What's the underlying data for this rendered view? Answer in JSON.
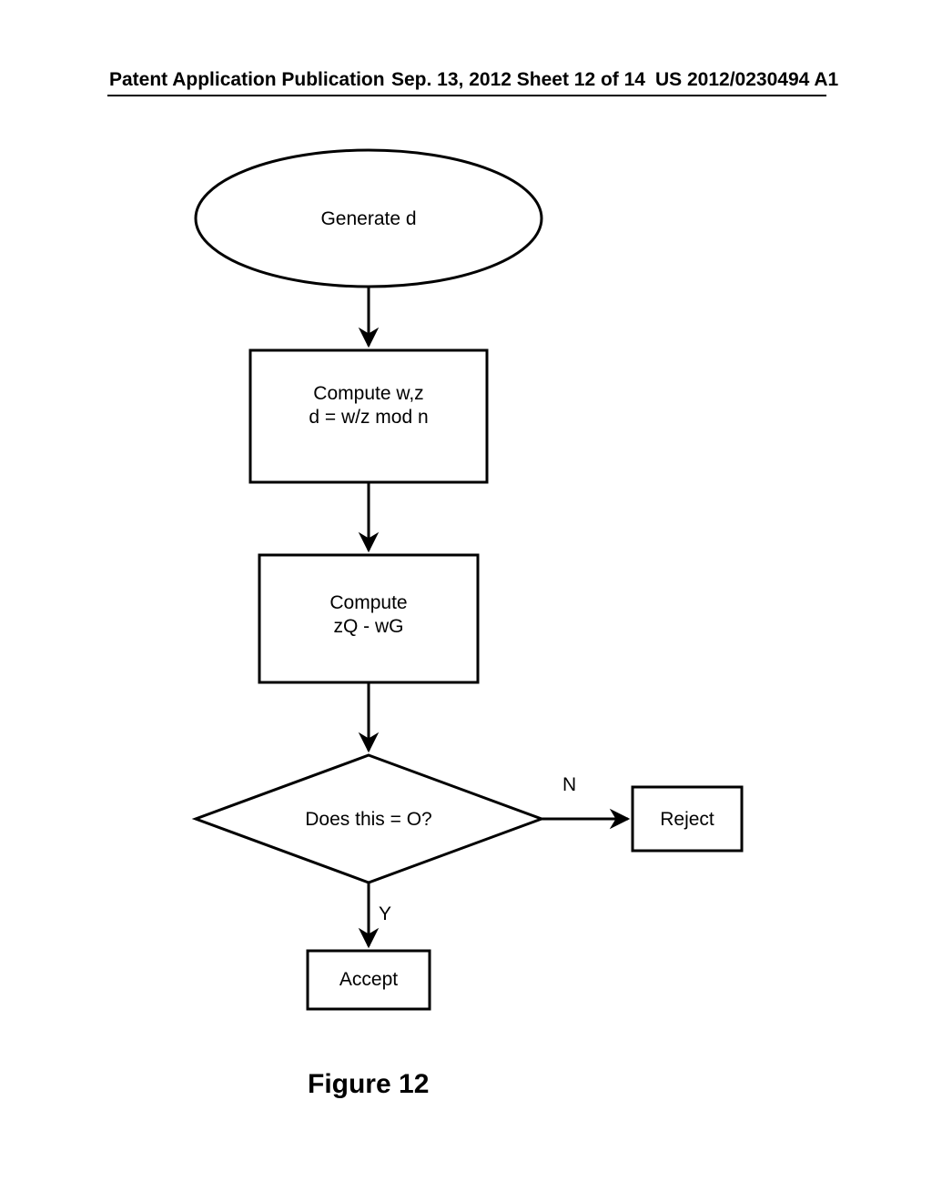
{
  "header": {
    "left": "Patent Application Publication",
    "center": "Sep. 13, 2012  Sheet 12 of 14",
    "right": "US 2012/0230494 A1"
  },
  "flow": {
    "start": "Generate d",
    "step1_line1": "Compute w,z",
    "step1_line2": "d = w/z mod n",
    "step2_line1": "Compute",
    "step2_line2": "zQ - wG",
    "decision": "Does this = O?",
    "branch_no": "N",
    "branch_yes": "Y",
    "reject": "Reject",
    "accept": "Accept"
  },
  "caption": "Figure 12"
}
